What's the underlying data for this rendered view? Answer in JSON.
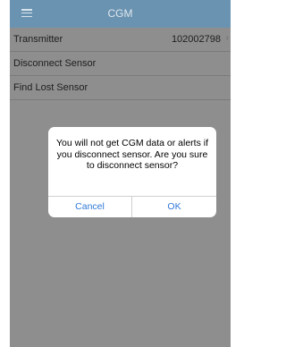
{
  "header": {
    "title": "CGM",
    "menu_icon": "hamburger-menu-icon"
  },
  "list": {
    "transmitter_label": "Transmitter",
    "transmitter_value": "102002798",
    "chevron_icon": "chevron-right-icon",
    "disconnect_label": "Disconnect Sensor",
    "find_lost_label": "Find Lost Sensor"
  },
  "dialog": {
    "message": "You will not get CGM data or alerts if you disconnect sensor. Are you sure to disconnect sensor?",
    "cancel_label": "Cancel",
    "ok_label": "OK"
  },
  "colors": {
    "navbar": "#6a93b1",
    "overlay_background": "#8e8e8e",
    "button_text": "#2f78d8"
  }
}
